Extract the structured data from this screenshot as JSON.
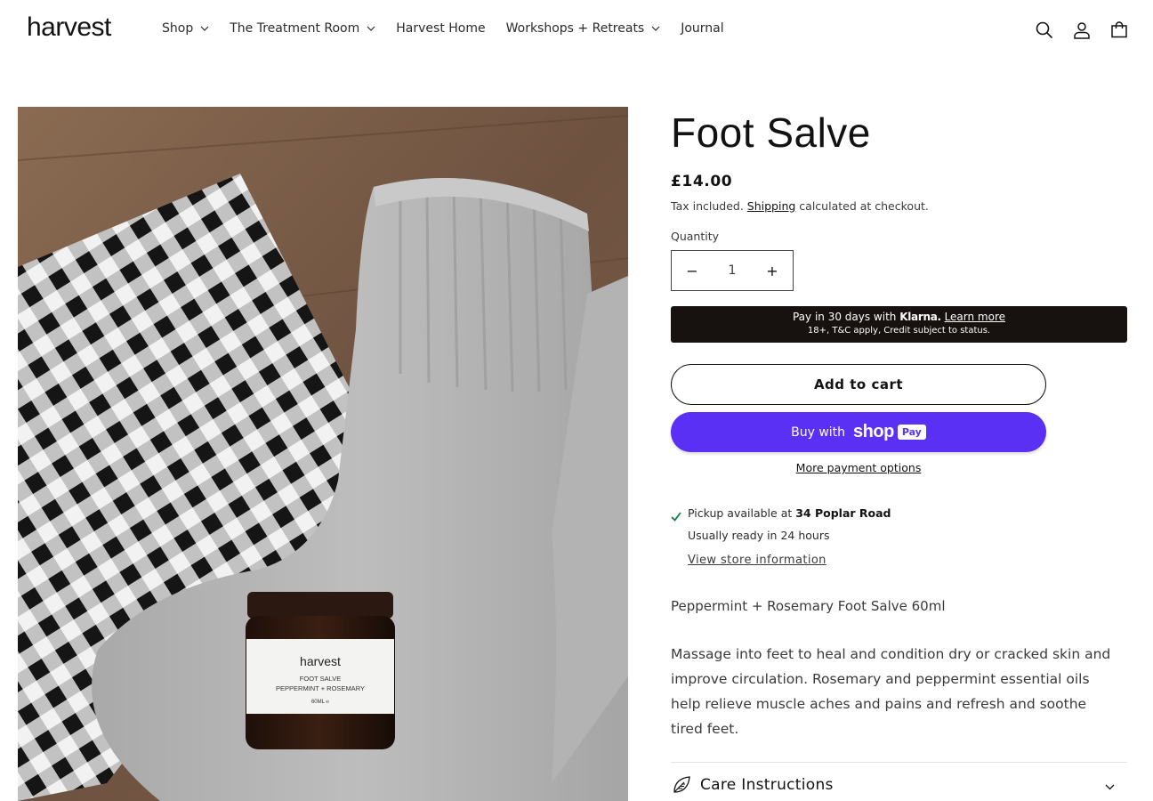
{
  "header": {
    "logo": "harvest",
    "nav": [
      {
        "label": "Shop",
        "has_dropdown": true
      },
      {
        "label": "The Treatment Room",
        "has_dropdown": true
      },
      {
        "label": "Harvest Home",
        "has_dropdown": false
      },
      {
        "label": "Workshops + Retreats",
        "has_dropdown": true
      },
      {
        "label": "Journal",
        "has_dropdown": false
      }
    ],
    "icons": [
      "search-icon",
      "account-icon",
      "cart-icon"
    ]
  },
  "media": {
    "jar_brand": "harvest",
    "jar_line1": "FOOT SALVE",
    "jar_line2": "PEPPERMINT + ROSEMARY",
    "jar_line3": "60ML ℮"
  },
  "product": {
    "title": "Foot Salve",
    "price": "£14.00",
    "tax_prefix": "Tax included.",
    "tax_link": "Shipping",
    "tax_suffix": "calculated at checkout.",
    "quantity_label": "Quantity",
    "quantity_value": "1",
    "minus": "−",
    "plus": "+"
  },
  "klarna": {
    "line1_prefix": "Pay in 30 days with",
    "brand": "Klarna.",
    "learn_more": "Learn more",
    "line2": "18+, T&C apply, Credit subject to status."
  },
  "buttons": {
    "add_to_cart": "Add to cart",
    "buy_with": "Buy with",
    "shop_word": "shop",
    "pay_pill": "Pay",
    "more_payment": "More payment options"
  },
  "pickup": {
    "prefix": "Pickup available at",
    "location": "34 Poplar Road",
    "ready": "Usually ready in 24 hours",
    "store_link": "View store information"
  },
  "description": {
    "subhead": "Peppermint + Rosemary Foot Salve 60ml",
    "body": "Massage into feet to heal and condition dry or cracked skin and improve circulation. Rosemary and peppermint essential oils help relieve muscle aches and pains and refresh and soothe tired feet."
  },
  "accordion": {
    "label": "Care Instructions",
    "icon": "leaf-icon"
  },
  "colors": {
    "text": "#121212",
    "shop_pay": "#5a31f4",
    "klarna_bg": "#17120f",
    "check": "#108043"
  }
}
